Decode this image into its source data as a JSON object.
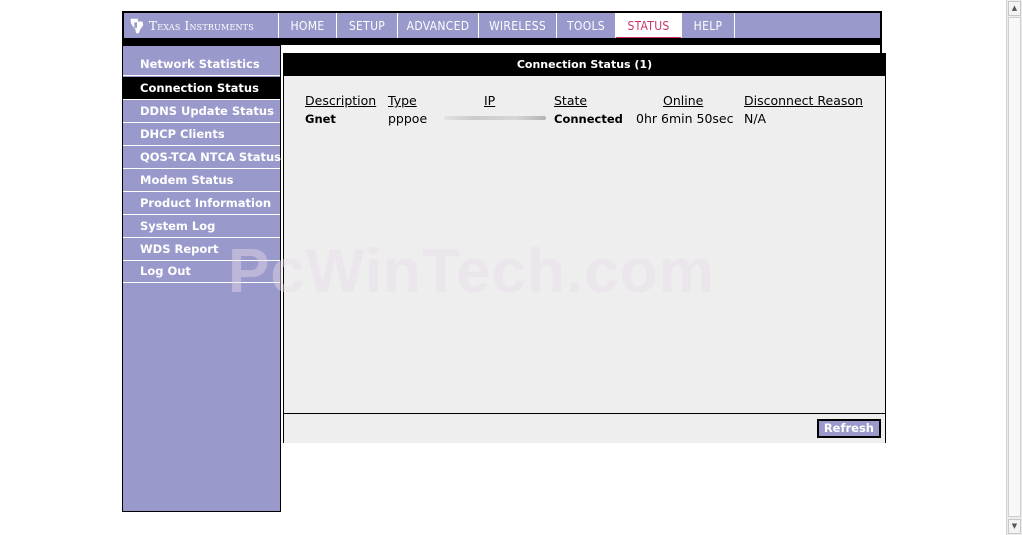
{
  "brand": {
    "name": "Texas Instruments"
  },
  "nav": {
    "tabs": [
      {
        "label": "HOME",
        "active": false
      },
      {
        "label": "SETUP",
        "active": false
      },
      {
        "label": "ADVANCED",
        "active": false
      },
      {
        "label": "WIRELESS",
        "active": false
      },
      {
        "label": "TOOLS",
        "active": false
      },
      {
        "label": "STATUS",
        "active": true
      },
      {
        "label": "HELP",
        "active": false
      }
    ]
  },
  "sidebar": {
    "items": [
      {
        "label": "Network Statistics",
        "active": false
      },
      {
        "label": "Connection Status",
        "active": true
      },
      {
        "label": "DDNS Update Status",
        "active": false
      },
      {
        "label": "DHCP Clients",
        "active": false
      },
      {
        "label": "QOS-TCA NTCA Status",
        "active": false
      },
      {
        "label": "Modem Status",
        "active": false
      },
      {
        "label": "Product Information",
        "active": false
      },
      {
        "label": "System Log",
        "active": false
      },
      {
        "label": "WDS Report",
        "active": false
      },
      {
        "label": "Log Out",
        "active": false
      }
    ]
  },
  "panel": {
    "title": "Connection Status (1)",
    "columns": [
      "Description",
      "Type",
      "IP",
      "State",
      "Online",
      "Disconnect Reason"
    ],
    "rows": [
      {
        "description": "Gnet",
        "type": "pppoe",
        "ip": "",
        "state": "Connected",
        "online": "0hr 6min 50sec",
        "disconnect_reason": "N/A"
      }
    ],
    "refresh_label": "Refresh"
  },
  "watermark": "PcWinTech.com",
  "colors": {
    "accent": "#9999cc",
    "active_tab": "#cc3366",
    "header_bg": "#000000"
  }
}
